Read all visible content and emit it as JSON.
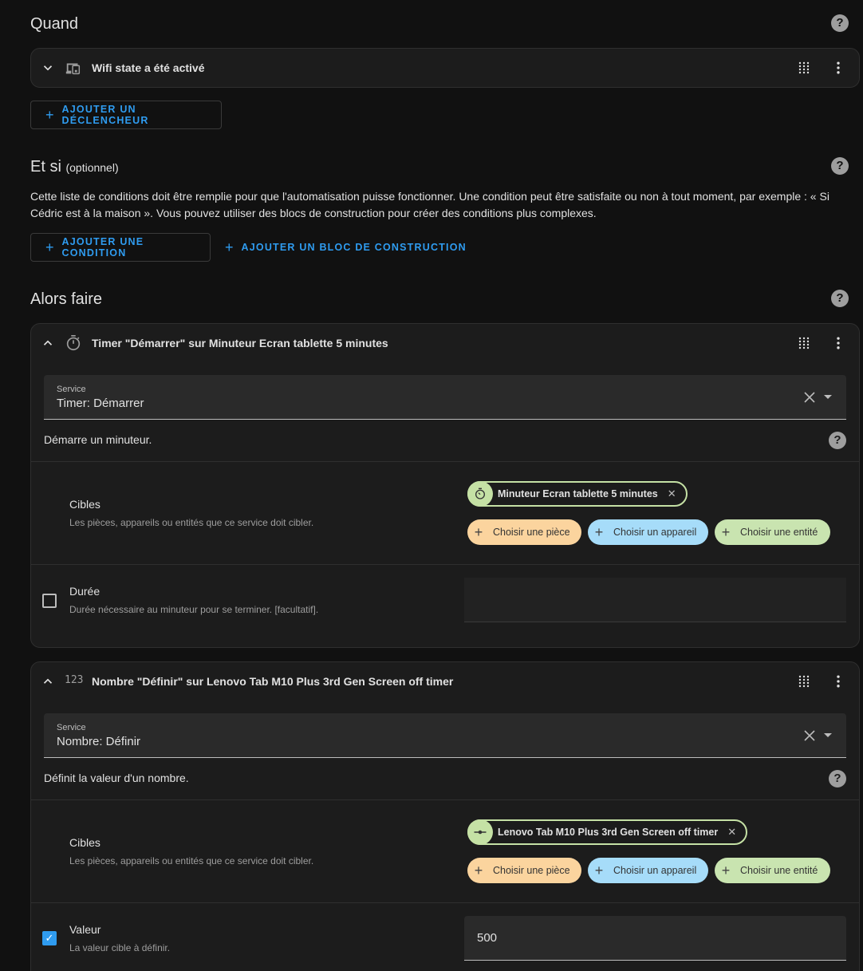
{
  "quand": {
    "title": "Quand",
    "trigger_title": "Wifi state a été activé",
    "add_trigger_label": "AJOUTER UN DÉCLENCHEUR"
  },
  "etsi": {
    "title": "Et si",
    "optional": "(optionnel)",
    "description": "Cette liste de conditions doit être remplie pour que l'automatisation puisse fonctionner. Une condition peut être satisfaite ou non à tout moment, par exemple : « Si Cédric est à la maison ». Vous pouvez utiliser des blocs de construction pour créer des conditions plus complexes.",
    "add_condition_label": "AJOUTER UNE CONDITION",
    "add_block_label": "AJOUTER UN BLOC DE CONSTRUCTION"
  },
  "alors": {
    "title": "Alors faire",
    "actions": [
      {
        "title": "Timer \"Démarrer\" sur Minuteur Ecran tablette 5 minutes",
        "service_label": "Service",
        "service_value": "Timer: Démarrer",
        "service_description": "Démarre un minuteur.",
        "targets_title": "Cibles",
        "targets_subtitle": "Les pièces, appareils ou entités que ce service doit cibler.",
        "target_entity": "Minuteur Ecran tablette 5 minutes",
        "choose_area": "Choisir une pièce",
        "choose_device": "Choisir un appareil",
        "choose_entity": "Choisir une entité",
        "field_title": "Durée",
        "field_subtitle": "Durée nécessaire au minuteur pour se terminer. [facultatif].",
        "field_checked": false
      },
      {
        "title": "Nombre \"Définir\" sur Lenovo Tab M10 Plus 3rd Gen Screen off timer",
        "service_label": "Service",
        "service_value": "Nombre: Définir",
        "service_description": "Définit la valeur d'un nombre.",
        "targets_title": "Cibles",
        "targets_subtitle": "Les pièces, appareils ou entités que ce service doit cibler.",
        "target_entity": "Lenovo Tab M10 Plus 3rd Gen Screen off timer",
        "choose_area": "Choisir une pièce",
        "choose_device": "Choisir un appareil",
        "choose_entity": "Choisir une entité",
        "field_title": "Valeur",
        "field_subtitle": "La valeur cible à définir.",
        "field_checked": true,
        "field_value": "500"
      }
    ]
  },
  "icons": {
    "help": "?",
    "number_icon": "123"
  },
  "colors": {
    "accent": "#2f9cf0",
    "area_chip": "#fbd49e",
    "device_chip": "#a6dcf9",
    "entity_chip": "#c9e4b0",
    "background": "#111111",
    "card": "#1c1c1c"
  }
}
